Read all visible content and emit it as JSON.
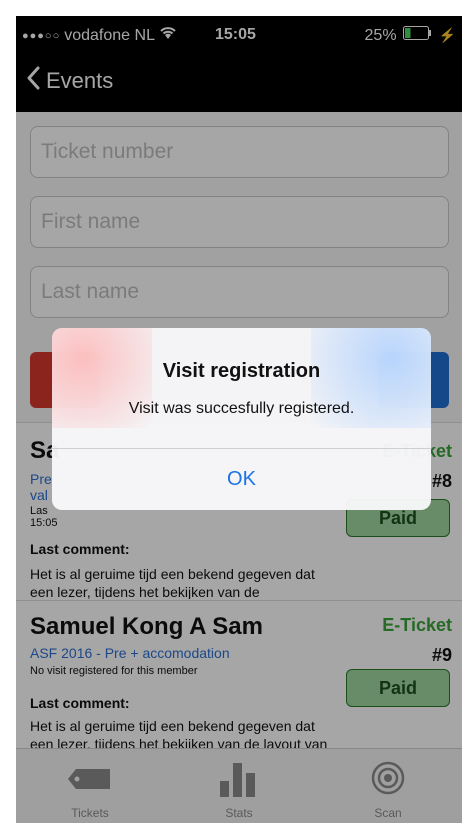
{
  "status_bar": {
    "signal": "●●●○○",
    "carrier": "vodafone NL",
    "time": "15:05",
    "battery_percent": "25%",
    "battery_level": 0.25
  },
  "nav": {
    "back_label": "Events"
  },
  "form": {
    "ticket_placeholder": "Ticket number",
    "first_name_placeholder": "First name",
    "last_name_placeholder": "Last name"
  },
  "cards": [
    {
      "name_visible": "Sa",
      "ticket_type": "E-Ticket",
      "number": "#8",
      "event_visible_1": "Pre",
      "event_visible_2": "val",
      "visit_visible_1": "Las",
      "visit_visible_2": "15:05",
      "paid_label": "Paid",
      "comment_label": "Last comment:",
      "comment_text": "Het is al geruime tijd een bekend gegeven dat een lezer, tijdens het bekijken van de"
    },
    {
      "name": "Samuel Kong A Sam",
      "ticket_type": "E-Ticket",
      "number": "#9",
      "event": "ASF 2016 - Pre + accomodation",
      "visit": "No visit registered for this member",
      "paid_label": "Paid",
      "comment_label": "Last comment:",
      "comment_text": "Het is al geruime tijd een bekend gegeven dat een lezer, tijdens het bekijken van de layout van een pagina, afgeleid wordt"
    }
  ],
  "tabs": [
    {
      "label": "Tickets",
      "icon": "ticket-icon"
    },
    {
      "label": "Stats",
      "icon": "stats-icon"
    },
    {
      "label": "Scan",
      "icon": "scan-icon"
    }
  ],
  "alert": {
    "title": "Visit registration",
    "message": "Visit was succesfully registered.",
    "ok_label": "OK"
  },
  "colors": {
    "eticket_green": "#3aa33a",
    "link_blue": "#2d6fd2",
    "paid_bg": "#9fd89f",
    "ok_blue": "#1a73e8"
  }
}
